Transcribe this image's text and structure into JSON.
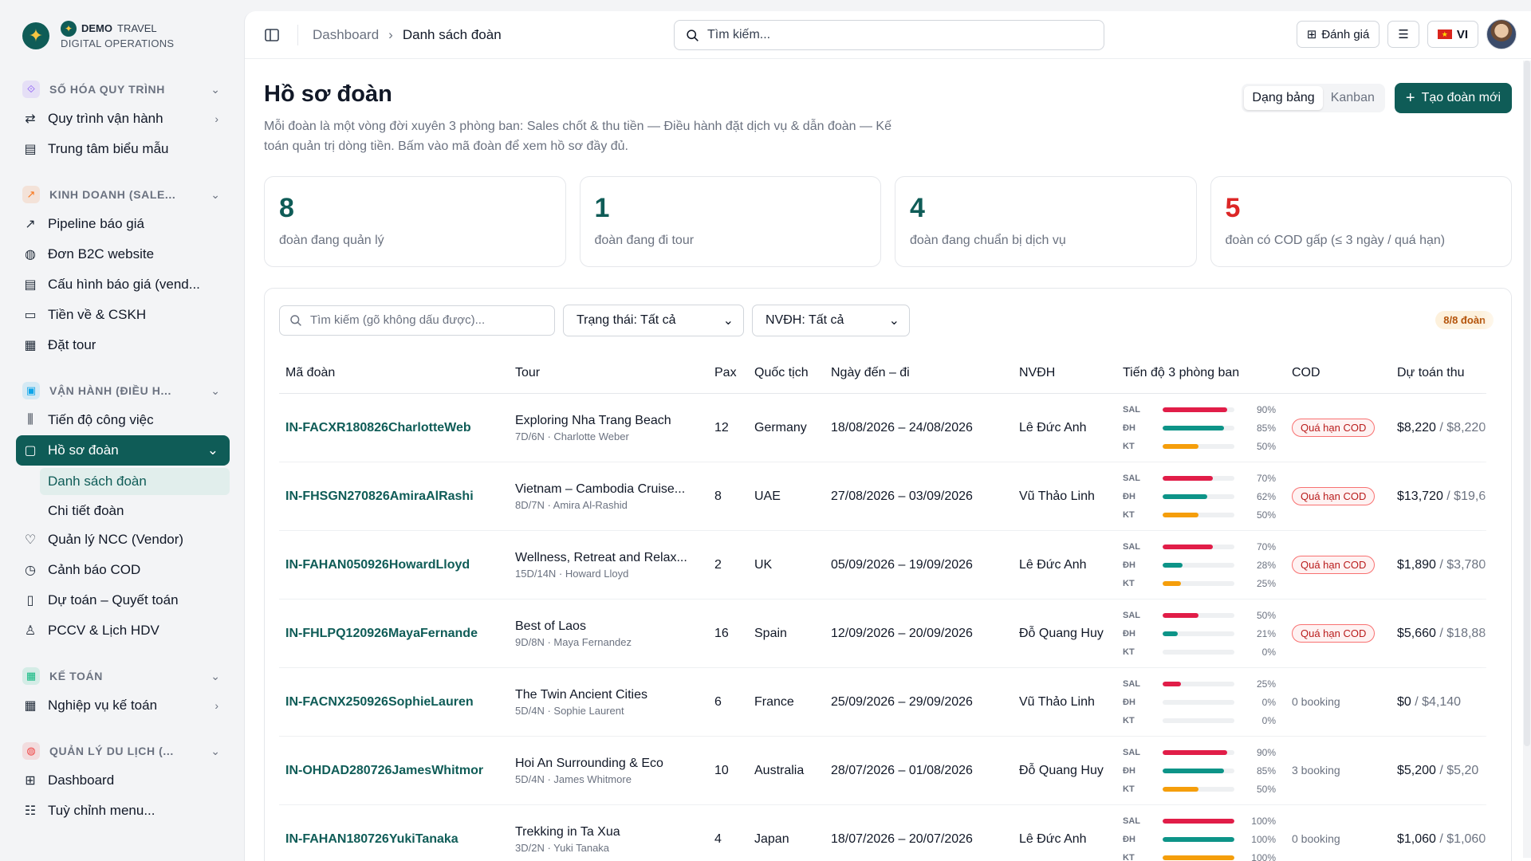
{
  "brand": {
    "name_bold": "DEMO",
    "name_light": "TRAVEL",
    "subtitle": "DIGITAL OPERATIONS"
  },
  "sidebar": {
    "sections": [
      {
        "label": "SỐ HÓA QUY TRÌNH",
        "icon": "workflow-icon",
        "color": "#8b5cf6",
        "items": [
          {
            "label": "Quy trình vận hành",
            "icon": "flow-icon",
            "has_arrow": true
          },
          {
            "label": "Trung tâm biểu mẫu",
            "icon": "document-icon"
          }
        ]
      },
      {
        "label": "KINH DOANH (SALE...",
        "icon": "trending-up-icon",
        "color": "#f97316",
        "items": [
          {
            "label": "Pipeline báo giá",
            "icon": "trending-icon"
          },
          {
            "label": "Đơn B2C website",
            "icon": "globe-icon"
          },
          {
            "label": "Cấu hình báo giá (vend...",
            "icon": "document-icon"
          },
          {
            "label": "Tiền về & CSKH",
            "icon": "cash-icon"
          },
          {
            "label": "Đặt tour",
            "icon": "clipboard-icon"
          }
        ]
      },
      {
        "label": "VẬN HÀNH (ĐIỀU H...",
        "icon": "briefcase-icon",
        "color": "#0ea5e9",
        "items": [
          {
            "label": "Tiến độ công việc",
            "icon": "bars-icon"
          },
          {
            "label": "Hồ sơ đoàn",
            "icon": "folder-icon",
            "active": true,
            "expanded": true,
            "children": [
              {
                "label": "Danh sách đoàn",
                "active": true
              },
              {
                "label": "Chi tiết đoàn"
              }
            ]
          },
          {
            "label": "Quản lý NCC (Vendor)",
            "icon": "handshake-icon"
          },
          {
            "label": "Cảnh báo COD",
            "icon": "alarm-icon"
          },
          {
            "label": "Dự toán – Quyết toán",
            "icon": "wallet-icon"
          },
          {
            "label": "PCCV & Lịch HDV",
            "icon": "users-icon"
          }
        ]
      },
      {
        "label": "KẾ TOÁN",
        "icon": "calculator-icon",
        "color": "#10b981",
        "items": [
          {
            "label": "Nghiệp vụ kế toán",
            "icon": "calculator-icon",
            "has_arrow": true
          }
        ]
      },
      {
        "label": "QUẢN LÝ DU LỊCH (...",
        "icon": "globe-icon",
        "color": "#ef4444",
        "items": [
          {
            "label": "Dashboard",
            "icon": "grid-icon"
          },
          {
            "label": "Tuỳ chỉnh menu...",
            "icon": "sliders-icon"
          }
        ]
      }
    ]
  },
  "topbar": {
    "breadcrumb": [
      "Dashboard",
      "Danh sách đoàn"
    ],
    "search_placeholder": "Tìm kiếm...",
    "feedback_label": "Đánh giá",
    "lang_label": "VI"
  },
  "page": {
    "title": "Hồ sơ đoàn",
    "description": "Mỗi đoàn là một vòng đời xuyên 3 phòng ban: Sales chốt & thu tiền — Điều hành đặt dịch vụ & dẫn đoàn — Kế toán quản trị dòng tiền. Bấm vào mã đoàn để xem hồ sơ đầy đủ.",
    "view_table": "Dạng bảng",
    "view_kanban": "Kanban",
    "create_label": "Tạo đoàn mới"
  },
  "stats": [
    {
      "value": "8",
      "label": "đoàn đang quản lý",
      "color": "#0f5c57"
    },
    {
      "value": "1",
      "label": "đoàn đang đi tour",
      "color": "#0f5c57"
    },
    {
      "value": "4",
      "label": "đoàn đang chuẩn bị dịch vụ",
      "color": "#0f5c57"
    },
    {
      "value": "5",
      "label": "đoàn có COD gấp (≤ 3 ngày / quá hạn)",
      "color": "#dc2626"
    }
  ],
  "filters": {
    "search_placeholder": "Tìm kiếm (gõ không dấu được)...",
    "status_label": "Trạng thái: Tất cả",
    "nvdh_label": "NVĐH: Tất cả",
    "count": "8/8 đoàn"
  },
  "table": {
    "columns": [
      "Mã đoàn",
      "Tour",
      "Pax",
      "Quốc tịch",
      "Ngày đến – đi",
      "NVĐH",
      "Tiến độ 3 phòng ban",
      "COD",
      "Dự toán thu"
    ],
    "progress_labels": [
      "SAL",
      "ĐH",
      "KT"
    ],
    "progress_colors": [
      "#e11d48",
      "#0d9488",
      "#f59e0b"
    ],
    "rows": [
      {
        "code": "IN-FACXR180826CharlotteWeb",
        "tour": "Exploring Nha Trang Beach",
        "tour_sub": "7D/6N · Charlotte Weber",
        "pax": "12",
        "nationality": "Germany",
        "dates": "18/08/2026 – 24/08/2026",
        "nvdh": "Lê Đức Anh",
        "progress": [
          90,
          85,
          50
        ],
        "cod": "Quá hạn COD",
        "cod_overdue": true,
        "money_a": "$8,220",
        "money_b": " / $8,220"
      },
      {
        "code": "IN-FHSGN270826AmiraAlRashi",
        "tour": "Vietnam – Cambodia Cruise...",
        "tour_sub": "8D/7N · Amira Al-Rashid",
        "pax": "8",
        "nationality": "UAE",
        "dates": "27/08/2026 – 03/09/2026",
        "nvdh": "Vũ Thảo Linh",
        "progress": [
          70,
          62,
          50
        ],
        "cod": "Quá hạn COD",
        "cod_overdue": true,
        "money_a": "$13,720",
        "money_b": " / $19,6"
      },
      {
        "code": "IN-FAHAN050926HowardLloyd",
        "tour": "Wellness, Retreat and Relax...",
        "tour_sub": "15D/14N · Howard Lloyd",
        "pax": "2",
        "nationality": "UK",
        "dates": "05/09/2026 – 19/09/2026",
        "nvdh": "Lê Đức Anh",
        "progress": [
          70,
          28,
          25
        ],
        "cod": "Quá hạn COD",
        "cod_overdue": true,
        "money_a": "$1,890",
        "money_b": " / $3,780"
      },
      {
        "code": "IN-FHLPQ120926MayaFernande",
        "tour": "Best of Laos",
        "tour_sub": "9D/8N · Maya Fernandez",
        "pax": "16",
        "nationality": "Spain",
        "dates": "12/09/2026 – 20/09/2026",
        "nvdh": "Đỗ Quang Huy",
        "progress": [
          50,
          21,
          0
        ],
        "cod": "Quá hạn COD",
        "cod_overdue": true,
        "money_a": "$5,660",
        "money_b": " / $18,88"
      },
      {
        "code": "IN-FACNX250926SophieLauren",
        "tour": "The Twin Ancient Cities",
        "tour_sub": "5D/4N · Sophie Laurent",
        "pax": "6",
        "nationality": "France",
        "dates": "25/09/2026 – 29/09/2026",
        "nvdh": "Vũ Thảo Linh",
        "progress": [
          25,
          0,
          0
        ],
        "cod": "0 booking",
        "cod_overdue": false,
        "money_a": "$0",
        "money_b": " / $4,140"
      },
      {
        "code": "IN-OHDAD280726JamesWhitmor",
        "tour": "Hoi An Surrounding & Eco",
        "tour_sub": "5D/4N · James Whitmore",
        "pax": "10",
        "nationality": "Australia",
        "dates": "28/07/2026 – 01/08/2026",
        "nvdh": "Đỗ Quang Huy",
        "progress": [
          90,
          85,
          50
        ],
        "cod": "3 booking",
        "cod_overdue": false,
        "money_a": "$5,200",
        "money_b": " / $5,20"
      },
      {
        "code": "IN-FAHAN180726YukiTanaka",
        "tour": "Trekking in Ta Xua",
        "tour_sub": "3D/2N · Yuki Tanaka",
        "pax": "4",
        "nationality": "Japan",
        "dates": "18/07/2026 – 20/07/2026",
        "nvdh": "Lê Đức Anh",
        "progress": [
          100,
          100,
          100
        ],
        "cod": "0 booking",
        "cod_overdue": false,
        "money_a": "$1,060",
        "money_b": " / $1,060"
      }
    ]
  }
}
